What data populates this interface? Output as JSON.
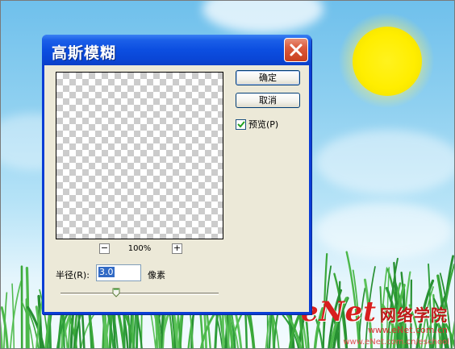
{
  "dialog": {
    "title": "高斯模糊",
    "buttons": {
      "ok": "确定",
      "cancel": "取消"
    },
    "preview_checkbox": {
      "label": "预览(P)",
      "checked": true
    },
    "zoom": {
      "minus": "−",
      "plus": "+",
      "level": "100%"
    },
    "radius": {
      "label": "半径(R):",
      "value": "3.0",
      "unit": "像素",
      "slider_fraction": 0.35
    },
    "icons": {
      "close": "close-icon",
      "checkmark": "checkmark-icon"
    }
  },
  "watermark": {
    "logo": "eNet",
    "logo_suffix": "网络学院",
    "url": "www.eNet.com.cn",
    "url_bottom": "www.eNet.com.cn/eschool"
  },
  "colors": {
    "titlebar": "#0a46d6",
    "close_button": "#db5a3c",
    "dialog_face": "#ece9d8",
    "sun": "#ffee00",
    "grass": "#3aa83a",
    "watermark": "#d81e1e"
  }
}
